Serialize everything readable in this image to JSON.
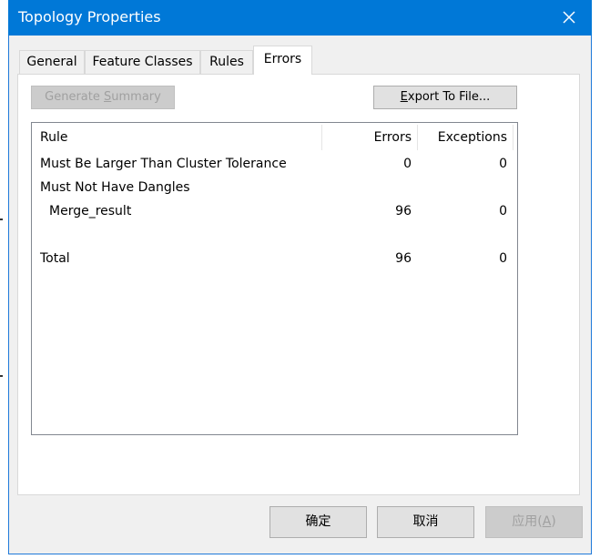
{
  "window": {
    "title": "Topology Properties",
    "close_icon": "close-icon"
  },
  "tabs": [
    {
      "label": "General",
      "active": false
    },
    {
      "label": "Feature Classes",
      "active": false
    },
    {
      "label": "Rules",
      "active": false
    },
    {
      "label": "Errors",
      "active": true
    }
  ],
  "errors_tab": {
    "generate_summary": {
      "label_pre": "Generate ",
      "label_underlined": "S",
      "label_post": "ummary",
      "enabled": false
    },
    "export_to_file": {
      "label_pre": "",
      "label_underlined": "E",
      "label_post": "xport To File...",
      "enabled": true
    },
    "table": {
      "columns": [
        "Rule",
        "Errors",
        "Exceptions"
      ],
      "rows": [
        {
          "rule": "Must Be Larger Than Cluster Tolerance",
          "errors": "0",
          "exceptions": "0"
        },
        {
          "rule": "Must Not Have Dangles",
          "errors": "",
          "exceptions": ""
        },
        {
          "rule": "Merge_result",
          "errors": "96",
          "exceptions": "0"
        },
        {
          "rule": "",
          "errors": "",
          "exceptions": ""
        },
        {
          "rule": "Total",
          "errors": "96",
          "exceptions": "0"
        }
      ]
    }
  },
  "footer": {
    "ok_label": "确定",
    "cancel_label": "取消",
    "apply_label_pre": "应用(",
    "apply_label_underlined": "A",
    "apply_label_post": ")",
    "apply_enabled": false
  }
}
